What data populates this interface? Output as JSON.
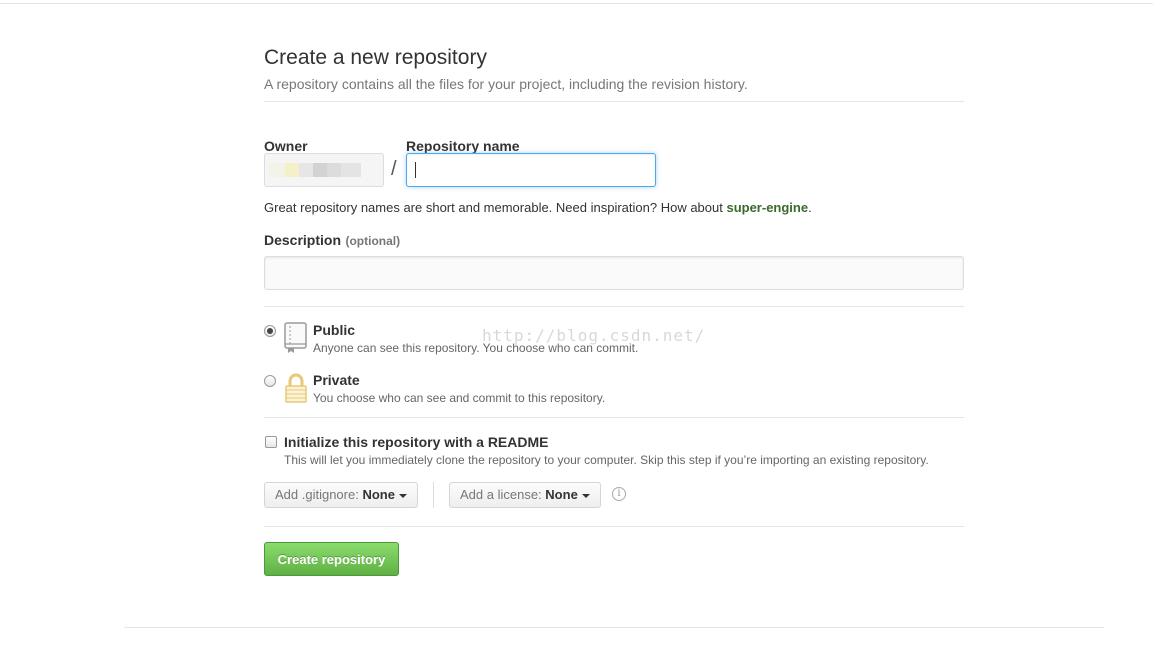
{
  "header": {
    "title": "Create a new repository",
    "subtitle": "A repository contains all the files for your project, including the revision history."
  },
  "owner": {
    "label": "Owner"
  },
  "repo_name": {
    "label": "Repository name",
    "separator": "/",
    "value": ""
  },
  "hint": {
    "text": "Great repository names are short and memorable. Need inspiration? How about ",
    "suggestion": "super-engine",
    "suffix": "."
  },
  "description": {
    "label": "Description",
    "optional": "(optional)",
    "value": ""
  },
  "visibility": {
    "selected": "public",
    "public": {
      "title": "Public",
      "desc": "Anyone can see this repository. You choose who can commit."
    },
    "private": {
      "title": "Private",
      "desc": "You choose who can see and commit to this repository."
    }
  },
  "readme": {
    "checked": false,
    "title": "Initialize this repository with a README",
    "desc": "This will let you immediately clone the repository to your computer. Skip this step if you’re importing an existing repository."
  },
  "gitignore": {
    "prefix": "Add .gitignore:",
    "value": "None"
  },
  "license": {
    "prefix": "Add a license:",
    "value": "None"
  },
  "create_button": {
    "label": "Create repository"
  },
  "watermark": "http://blog.csdn.net/",
  "colors": {
    "primary_button": "#60b044",
    "focus_border": "#51a7e8",
    "suggestion_link": "#3a6b2d"
  }
}
